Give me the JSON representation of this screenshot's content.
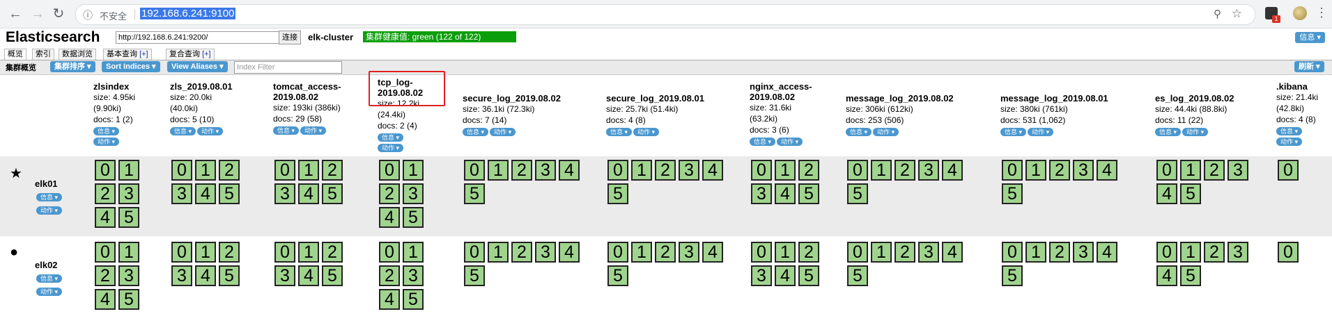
{
  "browser": {
    "info_icon": "info-icon",
    "insecure_label": "不安全",
    "url": "192.168.6.241:9100",
    "ext_badge": "1"
  },
  "app": {
    "title": "Elasticsearch",
    "connection_url": "http://192.168.6.241:9200/",
    "connect_label": "连接",
    "cluster_name": "elk-cluster",
    "health": "集群健康值: green (122 of 122)",
    "info_label": "信息"
  },
  "tabs": [
    {
      "label": "概览"
    },
    {
      "label": "索引"
    },
    {
      "label": "数据浏览"
    },
    {
      "label": "基本查询",
      "plus": "[+]"
    },
    {
      "label": "复合查询",
      "plus": "[+]"
    }
  ],
  "toolbar": {
    "overview": "集群概览",
    "sort_cluster": "集群排序",
    "sort_indices": "Sort Indices",
    "view_aliases": "View Aliases",
    "filter_placeholder": "Index Filter",
    "refresh": "刷新"
  },
  "pills": {
    "info": "信息",
    "action": "动作"
  },
  "indices": [
    {
      "name1": "zlsindex",
      "name2": "",
      "size": "size: 4.95ki",
      "size2": "(9.90ki)",
      "docs": "docs: 1 (2)"
    },
    {
      "name1": "zls_2019.08.01",
      "name2": "",
      "size": "size: 20.0ki",
      "size2": "(40.0ki)",
      "docs": "docs: 5 (10)"
    },
    {
      "name1": "tomcat_access-",
      "name2": "2019.08.02",
      "size": "size: 193ki (386ki)",
      "size2": "",
      "docs": "docs: 29 (58)"
    },
    {
      "name1": "tcp_log-",
      "name2": "2019.08.02",
      "size": "size: 12.2ki",
      "size2": "(24.4ki)",
      "docs": "docs: 2 (4)"
    },
    {
      "name1": "secure_log_2019.08.02",
      "name2": "",
      "size": "size: 36.1ki (72.3ki)",
      "size2": "",
      "docs": "docs: 7 (14)"
    },
    {
      "name1": "secure_log_2019.08.01",
      "name2": "",
      "size": "size: 25.7ki (51.4ki)",
      "size2": "",
      "docs": "docs: 4 (8)"
    },
    {
      "name1": "nginx_access-",
      "name2": "2019.08.02",
      "size": "size: 31.6ki",
      "size2": "(63.2ki)",
      "docs": "docs: 3 (6)"
    },
    {
      "name1": "message_log_2019.08.02",
      "name2": "",
      "size": "size: 306ki (612ki)",
      "size2": "",
      "docs": "docs: 253 (506)"
    },
    {
      "name1": "message_log_2019.08.01",
      "name2": "",
      "size": "size: 380ki (761ki)",
      "size2": "",
      "docs": "docs: 531 (1,062)"
    },
    {
      "name1": "es_log_2019.08.02",
      "name2": "",
      "size": "size: 44.4ki (88.8ki)",
      "size2": "",
      "docs": "docs: 11 (22)"
    },
    {
      "name1": ".kibana",
      "name2": "",
      "size": "size: 21.4ki",
      "size2": "(42.8ki)",
      "docs": "docs: 4 (8)"
    }
  ],
  "nodes": [
    {
      "name": "elk01",
      "icon": "star-icon",
      "glyph": "★"
    },
    {
      "name": "elk02",
      "icon": "circle-icon",
      "glyph": "●"
    }
  ],
  "shard_labels": [
    "0",
    "1",
    "2",
    "3",
    "4",
    "5"
  ],
  "colors": {
    "shard_fill": "#a0d48e",
    "health_green": "#0b9e0b",
    "button_blue": "#4a97cf",
    "highlight_red": "#e02020"
  }
}
